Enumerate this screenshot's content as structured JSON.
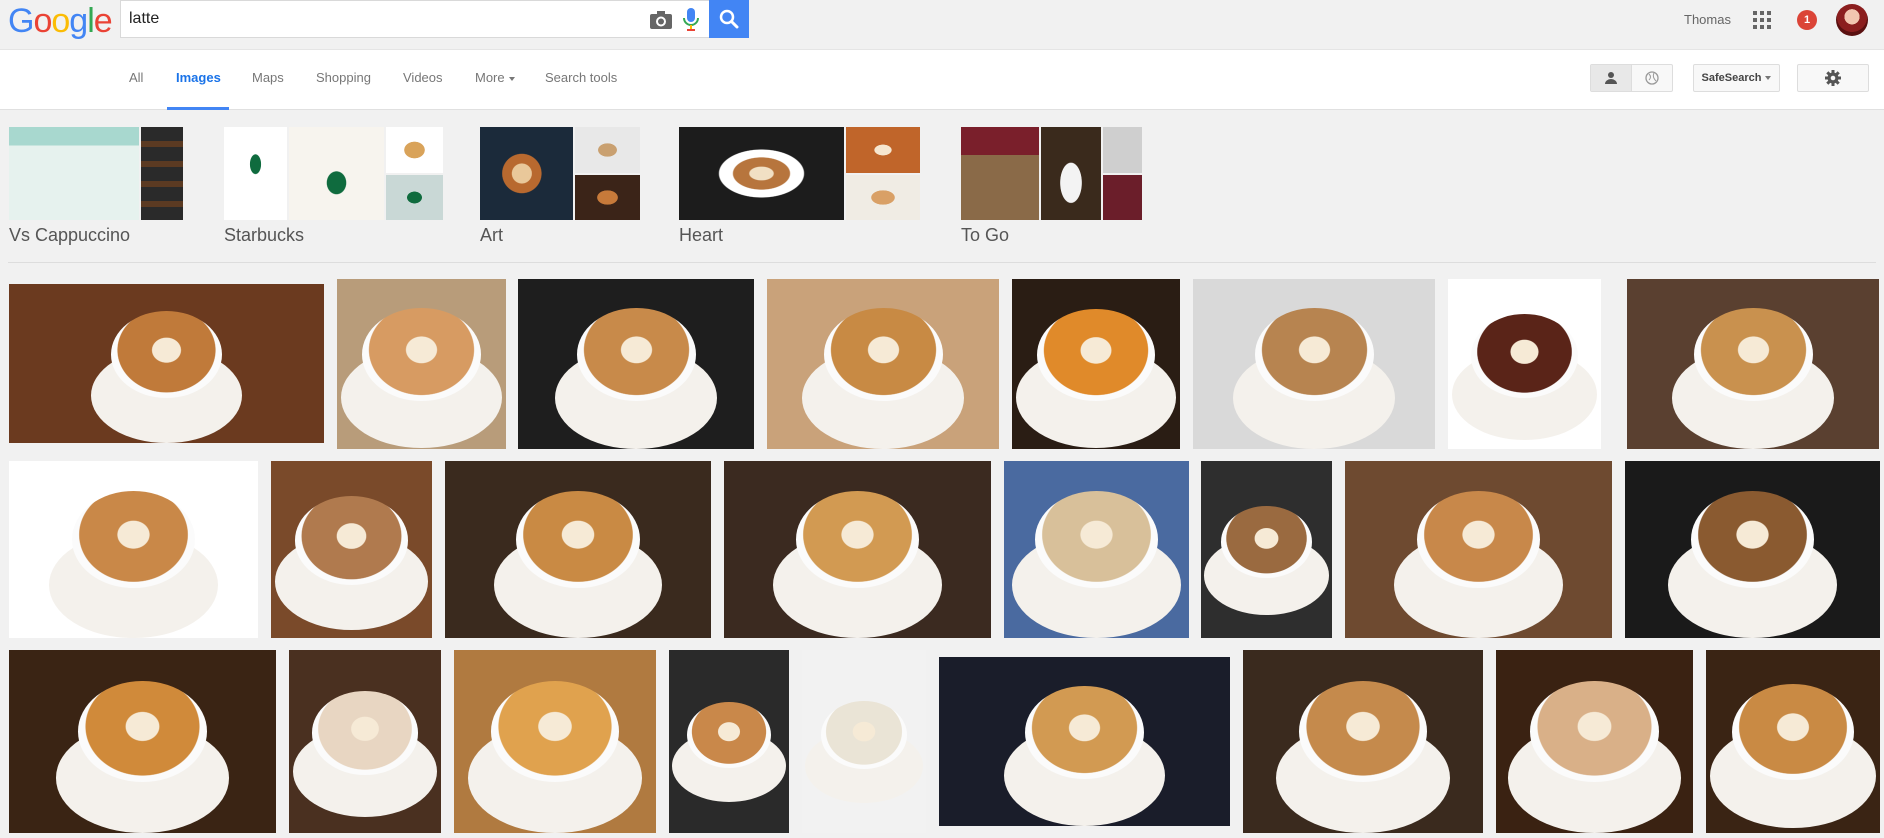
{
  "header": {
    "logo_text": "Google",
    "search_value": "latte",
    "user_name": "Thomas",
    "notification_count": "1",
    "icons": [
      "camera-icon",
      "mic-icon",
      "search-icon",
      "apps-icon",
      "avatar"
    ]
  },
  "nav": {
    "tabs": [
      "All",
      "Images",
      "Maps",
      "Shopping",
      "Videos",
      "More",
      "Search tools"
    ],
    "active_tab": "Images",
    "safesearch_label": "SafeSearch"
  },
  "related": [
    {
      "label": "Vs Cappuccino"
    },
    {
      "label": "Starbucks"
    },
    {
      "label": "Art"
    },
    {
      "label": "Heart"
    },
    {
      "label": "To Go"
    }
  ],
  "colors": {
    "accent": "#4285f4",
    "badge": "#db4437",
    "coffee_dark": "#5b3a22",
    "coffee_crema": "#c08040",
    "milk": "#f5ecd9"
  },
  "image_count": 26
}
